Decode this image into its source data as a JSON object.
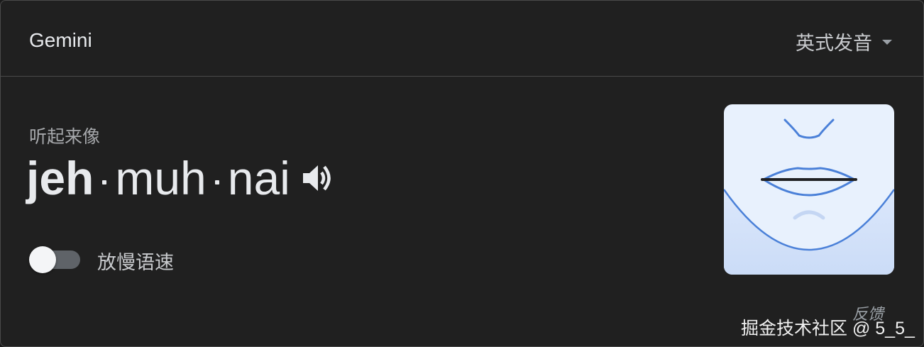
{
  "header": {
    "title": "Gemini",
    "accent_dropdown_label": "英式发音"
  },
  "pronunciation": {
    "subtitle": "听起来像",
    "syllables": [
      "jeh",
      "muh",
      "nai"
    ],
    "speaker_icon": "volume-up-icon"
  },
  "slow_toggle": {
    "label": "放慢语速",
    "checked": false
  },
  "mouth_illustration": {
    "icon": "mouth-diagram-icon"
  },
  "footer": {
    "feedback_label": "反馈",
    "watermark": "掘金技术社区 @ 5_5_"
  },
  "colors": {
    "background": "#202020",
    "border": "#4a4a4a",
    "text_primary": "#e8eaed",
    "text_secondary": "#a6a8ab",
    "illustration_line": "#4a80d8",
    "illustration_bg": "#e8f1fd"
  }
}
